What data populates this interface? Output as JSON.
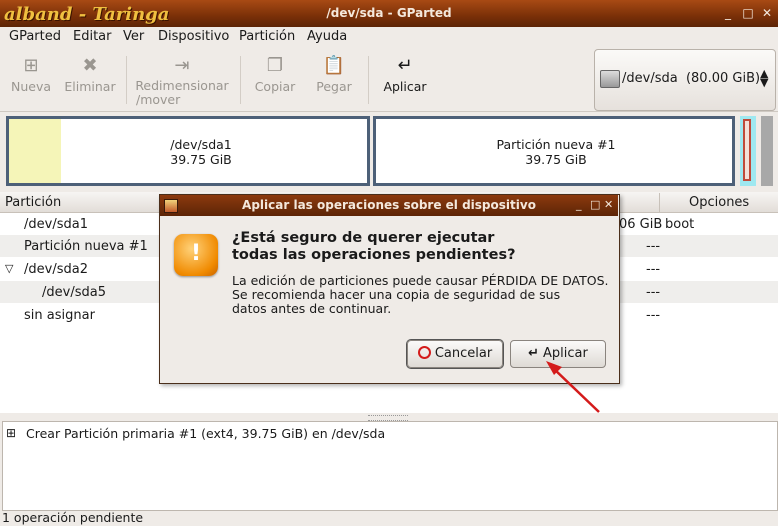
{
  "titlebar": {
    "brand": "alband - Taringa",
    "title": "/dev/sda - GParted"
  },
  "menu": {
    "items": [
      "GParted",
      "Editar",
      "Ver",
      "Dispositivo",
      "Partición",
      "Ayuda"
    ]
  },
  "toolbar": {
    "nueva": "Nueva",
    "eliminar": "Eliminar",
    "redimensionar_1": "Redimensionar",
    "redimensionar_2": "/mover",
    "copiar": "Copiar",
    "pegar": "Pegar",
    "aplicar": "Aplicar"
  },
  "device": {
    "name": "/dev/sda",
    "size": "(80.00 GiB)"
  },
  "graph": {
    "p1": {
      "name": "/dev/sda1",
      "size": "39.75 GiB"
    },
    "p2": {
      "name": "Partición nueva #1",
      "size": "39.75 GiB"
    }
  },
  "list": {
    "col_particion": "Partición",
    "col_opciones": "Opciones",
    "rows": [
      {
        "name": "/dev/sda1",
        "size": "06 GiB",
        "flags": "boot"
      },
      {
        "name": "Partición nueva #1",
        "flags": "---"
      },
      {
        "name": "/dev/sda2",
        "flags": "---"
      },
      {
        "name": "/dev/sda5",
        "flags": "---"
      },
      {
        "name": "sin asignar",
        "flags": "---"
      }
    ]
  },
  "ops": {
    "item": "Crear Partición primaria #1 (ext4, 39.75 GiB) en /dev/sda"
  },
  "status": "1 operación pendiente",
  "dialog": {
    "title": "Aplicar las operaciones sobre el dispositivo",
    "heading_1": "¿Está seguro de querer ejecutar",
    "heading_2": "todas las operaciones pendientes?",
    "body_1": "La edición de particiones puede causar PÉRDIDA DE DATOS.",
    "body_2": "Se recomienda hacer una copia de seguridad de sus",
    "body_3": "datos antes de continuar.",
    "cancel": "Cancelar",
    "apply": "Aplicar"
  },
  "colors": {
    "accent": "#4d6078",
    "titlebar": "#7a3008",
    "arrow": "#d41b1b",
    "sda1_used": "#f5f5b8"
  }
}
